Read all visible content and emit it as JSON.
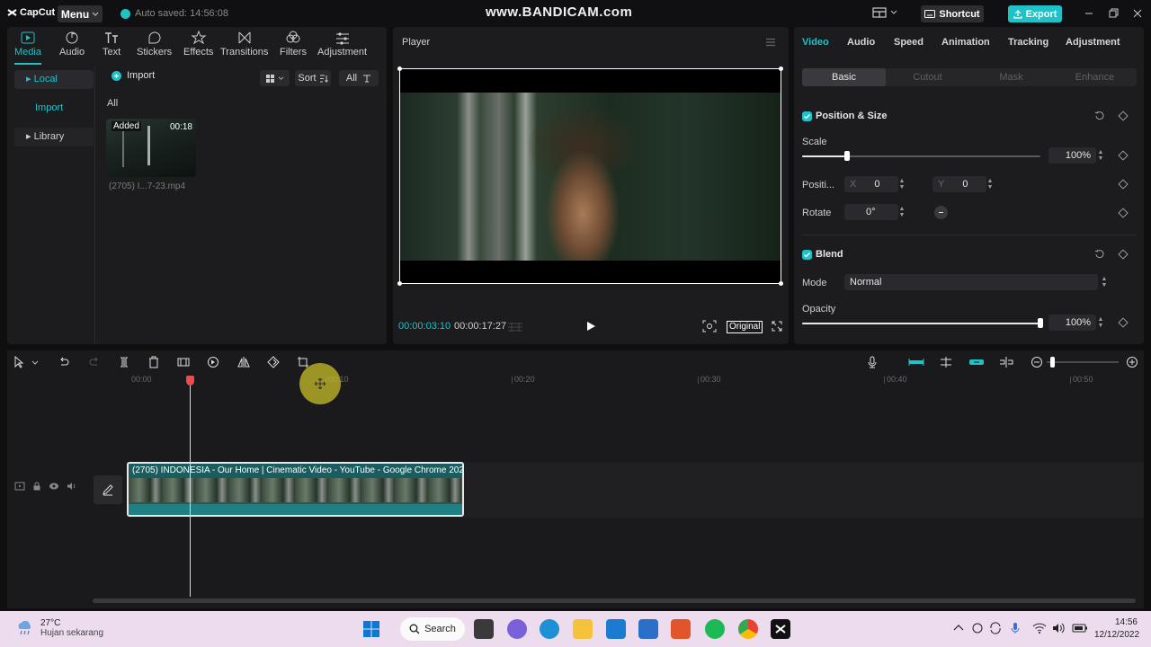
{
  "titlebar": {
    "app_name": "CapCut",
    "menu_label": "Menu",
    "autosave_text": "Auto saved: 14:56:08",
    "watermark": "www.BANDICAM.com",
    "shortcut_label": "Shortcut",
    "export_label": "Export"
  },
  "media_panel": {
    "tabs": [
      {
        "label": "Media",
        "icon": "media-icon"
      },
      {
        "label": "Audio",
        "icon": "audio-icon"
      },
      {
        "label": "Text",
        "icon": "text-icon"
      },
      {
        "label": "Stickers",
        "icon": "stickers-icon"
      },
      {
        "label": "Effects",
        "icon": "effects-icon"
      },
      {
        "label": "Transitions",
        "icon": "transitions-icon"
      },
      {
        "label": "Filters",
        "icon": "filters-icon"
      },
      {
        "label": "Adjustment",
        "icon": "adjustment-icon"
      }
    ],
    "sidebar": {
      "local": "Local",
      "import": "Import",
      "library": "Library"
    },
    "import_label": "Import",
    "sort_label": "Sort",
    "filter_label": "All",
    "section_label": "All",
    "item": {
      "badge": "Added",
      "duration": "00:18",
      "name": "(2705) I...7-23.mp4"
    }
  },
  "player": {
    "title": "Player",
    "current_time": "00:00:03:10",
    "total_time": "00:00:17:27",
    "original_label": "Original"
  },
  "properties": {
    "tabs": [
      "Video",
      "Audio",
      "Speed",
      "Animation",
      "Tracking",
      "Adjustment"
    ],
    "subtabs": [
      "Basic",
      "Cutout",
      "Mask",
      "Enhance"
    ],
    "position_size": {
      "title": "Position & Size",
      "scale_label": "Scale",
      "scale_value": "100%",
      "scale_fraction": 0.19,
      "position_label": "Positi...",
      "x_label": "X",
      "x_value": "0",
      "y_label": "Y",
      "y_value": "0",
      "rotate_label": "Rotate",
      "rotate_value": "0°"
    },
    "blend": {
      "title": "Blend",
      "mode_label": "Mode",
      "mode_value": "Normal",
      "opacity_label": "Opacity",
      "opacity_value": "100%",
      "opacity_fraction": 1.0
    }
  },
  "timeline": {
    "ruler": [
      "00:00",
      "00:10",
      "00:20",
      "00:30",
      "00:40",
      "00:50"
    ],
    "clip_title": "(2705) INDONESIA - Our Home | Cinematic Video - YouTube - Google Chrome 2022"
  },
  "taskbar": {
    "temperature": "27°C",
    "weather_desc": "Hujan sekarang",
    "search_label": "Search",
    "time": "14:56",
    "date": "12/12/2022"
  },
  "colors": {
    "accent": "#20c1c7",
    "panel": "#1c1c1e",
    "background": "#0f0f10"
  }
}
